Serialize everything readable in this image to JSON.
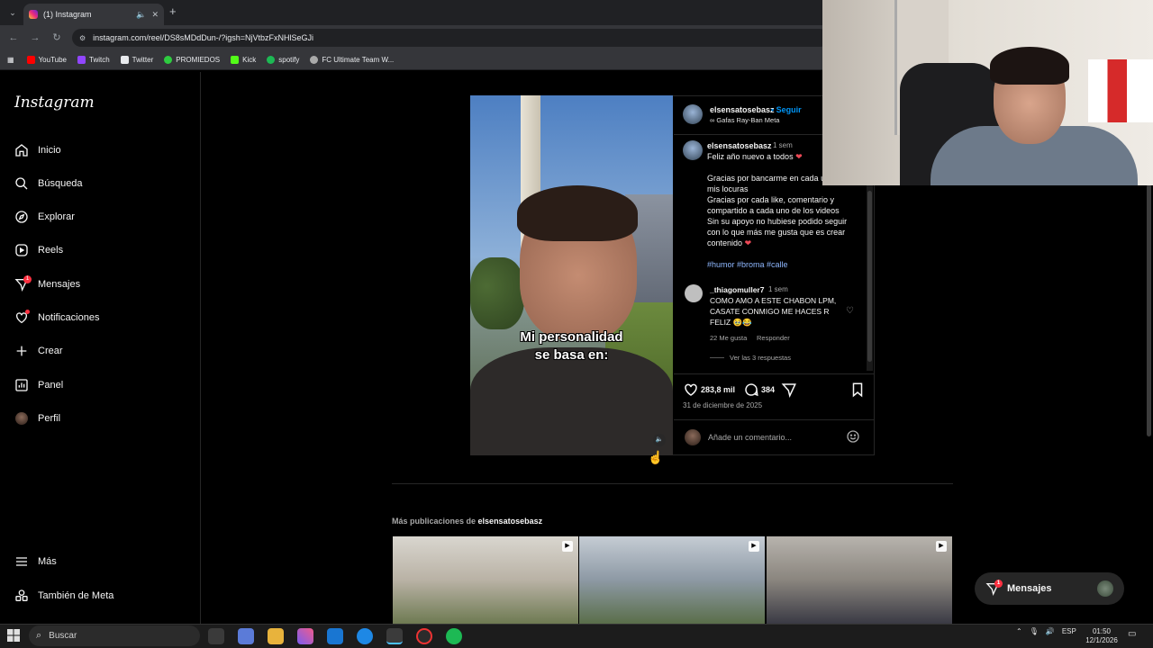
{
  "browser": {
    "tab_title": "(1) Instagram",
    "url": "instagram.com/reel/DS8sMDdDun-/?igsh=NjVtbzFxNHlSeGJi",
    "bookmarks": [
      {
        "label": "YouTube",
        "color": "#ff0000"
      },
      {
        "label": "Twitch",
        "color": "#9146ff"
      },
      {
        "label": "Twitter",
        "color": "#e8eaed"
      },
      {
        "label": "PROMIEDOS",
        "color": "#2ecc40"
      },
      {
        "label": "Kick",
        "color": "#53fc18"
      },
      {
        "label": "spotify",
        "color": "#1db954"
      },
      {
        "label": "FC Ultimate Team W...",
        "color": "#aaaaaa"
      }
    ]
  },
  "sidebar": {
    "logo": "Instagram",
    "items": [
      {
        "label": "Inicio",
        "icon": "home-icon"
      },
      {
        "label": "Búsqueda",
        "icon": "search-icon"
      },
      {
        "label": "Explorar",
        "icon": "compass-icon"
      },
      {
        "label": "Reels",
        "icon": "reels-icon"
      },
      {
        "label": "Mensajes",
        "icon": "messenger-icon",
        "badge": "1"
      },
      {
        "label": "Notificaciones",
        "icon": "heart-icon"
      },
      {
        "label": "Crear",
        "icon": "plus-icon"
      },
      {
        "label": "Panel",
        "icon": "chart-icon"
      },
      {
        "label": "Perfil",
        "icon": "profile-avatar"
      }
    ],
    "more": "Más",
    "meta": "También de Meta"
  },
  "post": {
    "video_caption_line1": "Mi personalidad",
    "video_caption_line2": "se basa en:",
    "author": "elsensatosebasz",
    "follow": "• Seguir",
    "subtitle": "∞ Gafas Ray-Ban Meta",
    "caption": {
      "user": "elsensatosebasz",
      "time": "1 sem",
      "lines": [
        "Feliz año nuevo a todos",
        "",
        "Gracias por bancarme en cada u",
        "mis locuras",
        "Gracias por cada like, comentario y",
        "compartido a cada uno de los videos",
        "Sin su apoyo no hubiese podido seguir",
        "con lo que más me gusta que es crear",
        "contenido"
      ],
      "hashtags": "#humor #broma #calle"
    },
    "comment": {
      "user": "_thiagomuller7",
      "time": "1 sem",
      "lines": [
        "COMO AMO A ESTE CHABON LPM,",
        "CASATE CONMIGO ME HACES R",
        "FELIZ 🥹😂"
      ],
      "likes": "22 Me gusta",
      "reply": "Responder",
      "view_replies": "Ver las 3 respuestas"
    },
    "like_count": "283,8 mil",
    "comment_count": "384",
    "date": "31 de diciembre de 2025",
    "comment_placeholder": "Añade un comentario..."
  },
  "more_posts": {
    "label_prefix": "Más publicaciones de",
    "label_user": "elsensatosebasz"
  },
  "floating_messages": {
    "label": "Mensajes",
    "badge": "1"
  },
  "taskbar": {
    "search": "Buscar",
    "tray_lang": "ESP",
    "time": "01:50",
    "date": "12/1/2026"
  },
  "colors": {
    "accent": "#0095f6",
    "like": "#ed4956",
    "badge": "#ff3040"
  }
}
